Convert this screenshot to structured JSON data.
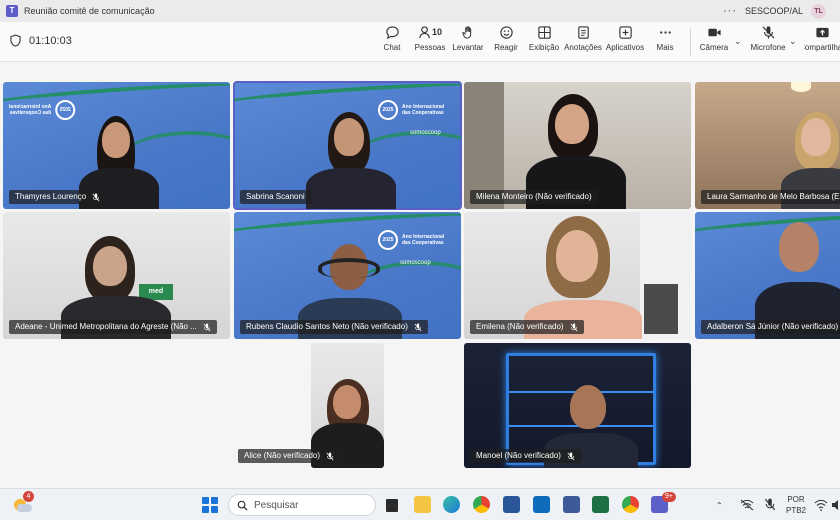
{
  "window": {
    "title": "Reunião comitê de comunicação",
    "org": "SESCOOP/AL",
    "avatar_initials": "TL",
    "more": "···"
  },
  "meeting": {
    "elapsed": "01:10:03",
    "toolbar": [
      {
        "id": "chat",
        "label": "Chat",
        "icon": "chat-icon"
      },
      {
        "id": "people",
        "label": "Pessoas",
        "icon": "people-icon",
        "count": "10"
      },
      {
        "id": "raise",
        "label": "Levantar",
        "icon": "hand-icon"
      },
      {
        "id": "react",
        "label": "Reagir",
        "icon": "smile-icon"
      },
      {
        "id": "view",
        "label": "Exibição",
        "icon": "grid-icon"
      },
      {
        "id": "notes",
        "label": "Anotações",
        "icon": "notes-icon"
      },
      {
        "id": "apps",
        "label": "Aplicativos",
        "icon": "plus-icon"
      },
      {
        "id": "more",
        "label": "Mais",
        "icon": "more-icon"
      },
      {
        "id": "camera",
        "label": "Câmera",
        "icon": "camera-icon"
      },
      {
        "id": "mic",
        "label": "Microfone",
        "icon": "mic-off-icon"
      },
      {
        "id": "share",
        "label": "Compartilhar",
        "icon": "share-icon"
      }
    ]
  },
  "background_branding": {
    "line1": "Ano Internacional",
    "line2": "das Cooperativas",
    "year": "2025",
    "brand": "somoscoop"
  },
  "participants": [
    {
      "name": "Thamyres Lourenço",
      "muted": true
    },
    {
      "name": "Sabrina Scanoni",
      "muted": false,
      "active": true
    },
    {
      "name": "Milena Monteiro (Não verificado)",
      "muted": false
    },
    {
      "name": "Laura Sarmanho de Melo Barbosa (Ext",
      "muted": false
    },
    {
      "name": "Adeane - Unimed Metropolitana do Agreste (Não ...",
      "muted": true
    },
    {
      "name": "Rubens Claudio Santos Neto (Não verificado)",
      "muted": true
    },
    {
      "name": "Emilena (Não verificado)",
      "muted": true
    },
    {
      "name": "Adalberon Sá Júnior (Não verificado)",
      "muted": false
    },
    {
      "name": "Alice (Não verificado)",
      "muted": true
    },
    {
      "name": "Manoel (Não verificado)",
      "muted": true
    }
  ],
  "taskbar": {
    "weather_badge": "4",
    "search_placeholder": "Pesquisar",
    "teams_badge": "9+",
    "lang_line1": "POR",
    "lang_line2": "PTB2"
  },
  "colors": {
    "accent": "#5b5fc7",
    "branding_blue": "#4a78c8",
    "branding_green": "#1f8f5c"
  }
}
